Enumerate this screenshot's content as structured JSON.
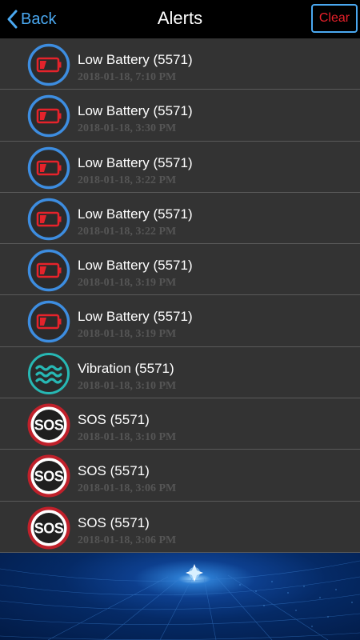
{
  "navbar": {
    "back_label": "Back",
    "title": "Alerts",
    "clear_label": "Clear"
  },
  "colors": {
    "accent_blue": "#4aa8f0",
    "clear_red": "#e8202a",
    "row_bg": "#333333",
    "battery_ring": "#3d8de0",
    "vibration_ring": "#27b8b4",
    "sos_ring": "#c0202a"
  },
  "alerts": [
    {
      "icon": "low-battery-icon",
      "title": "Low Battery (5571)",
      "time": "2018-01-18, 7:10 PM"
    },
    {
      "icon": "low-battery-icon",
      "title": "Low Battery (5571)",
      "time": "2018-01-18, 3:30 PM"
    },
    {
      "icon": "low-battery-icon",
      "title": "Low Battery (5571)",
      "time": "2018-01-18, 3:22 PM"
    },
    {
      "icon": "low-battery-icon",
      "title": "Low Battery (5571)",
      "time": "2018-01-18, 3:22 PM"
    },
    {
      "icon": "low-battery-icon",
      "title": "Low Battery (5571)",
      "time": "2018-01-18, 3:19 PM"
    },
    {
      "icon": "low-battery-icon",
      "title": "Low Battery (5571)",
      "time": "2018-01-18, 3:19 PM"
    },
    {
      "icon": "vibration-icon",
      "title": "Vibration (5571)",
      "time": "2018-01-18, 3:10 PM"
    },
    {
      "icon": "sos-icon",
      "title": "SOS (5571)",
      "time": "2018-01-18, 3:10 PM",
      "badge": "SOS"
    },
    {
      "icon": "sos-icon",
      "title": "SOS (5571)",
      "time": "2018-01-18, 3:06 PM",
      "badge": "SOS"
    },
    {
      "icon": "sos-icon",
      "title": "SOS (5571)",
      "time": "2018-01-18, 3:06 PM",
      "badge": "SOS"
    }
  ]
}
